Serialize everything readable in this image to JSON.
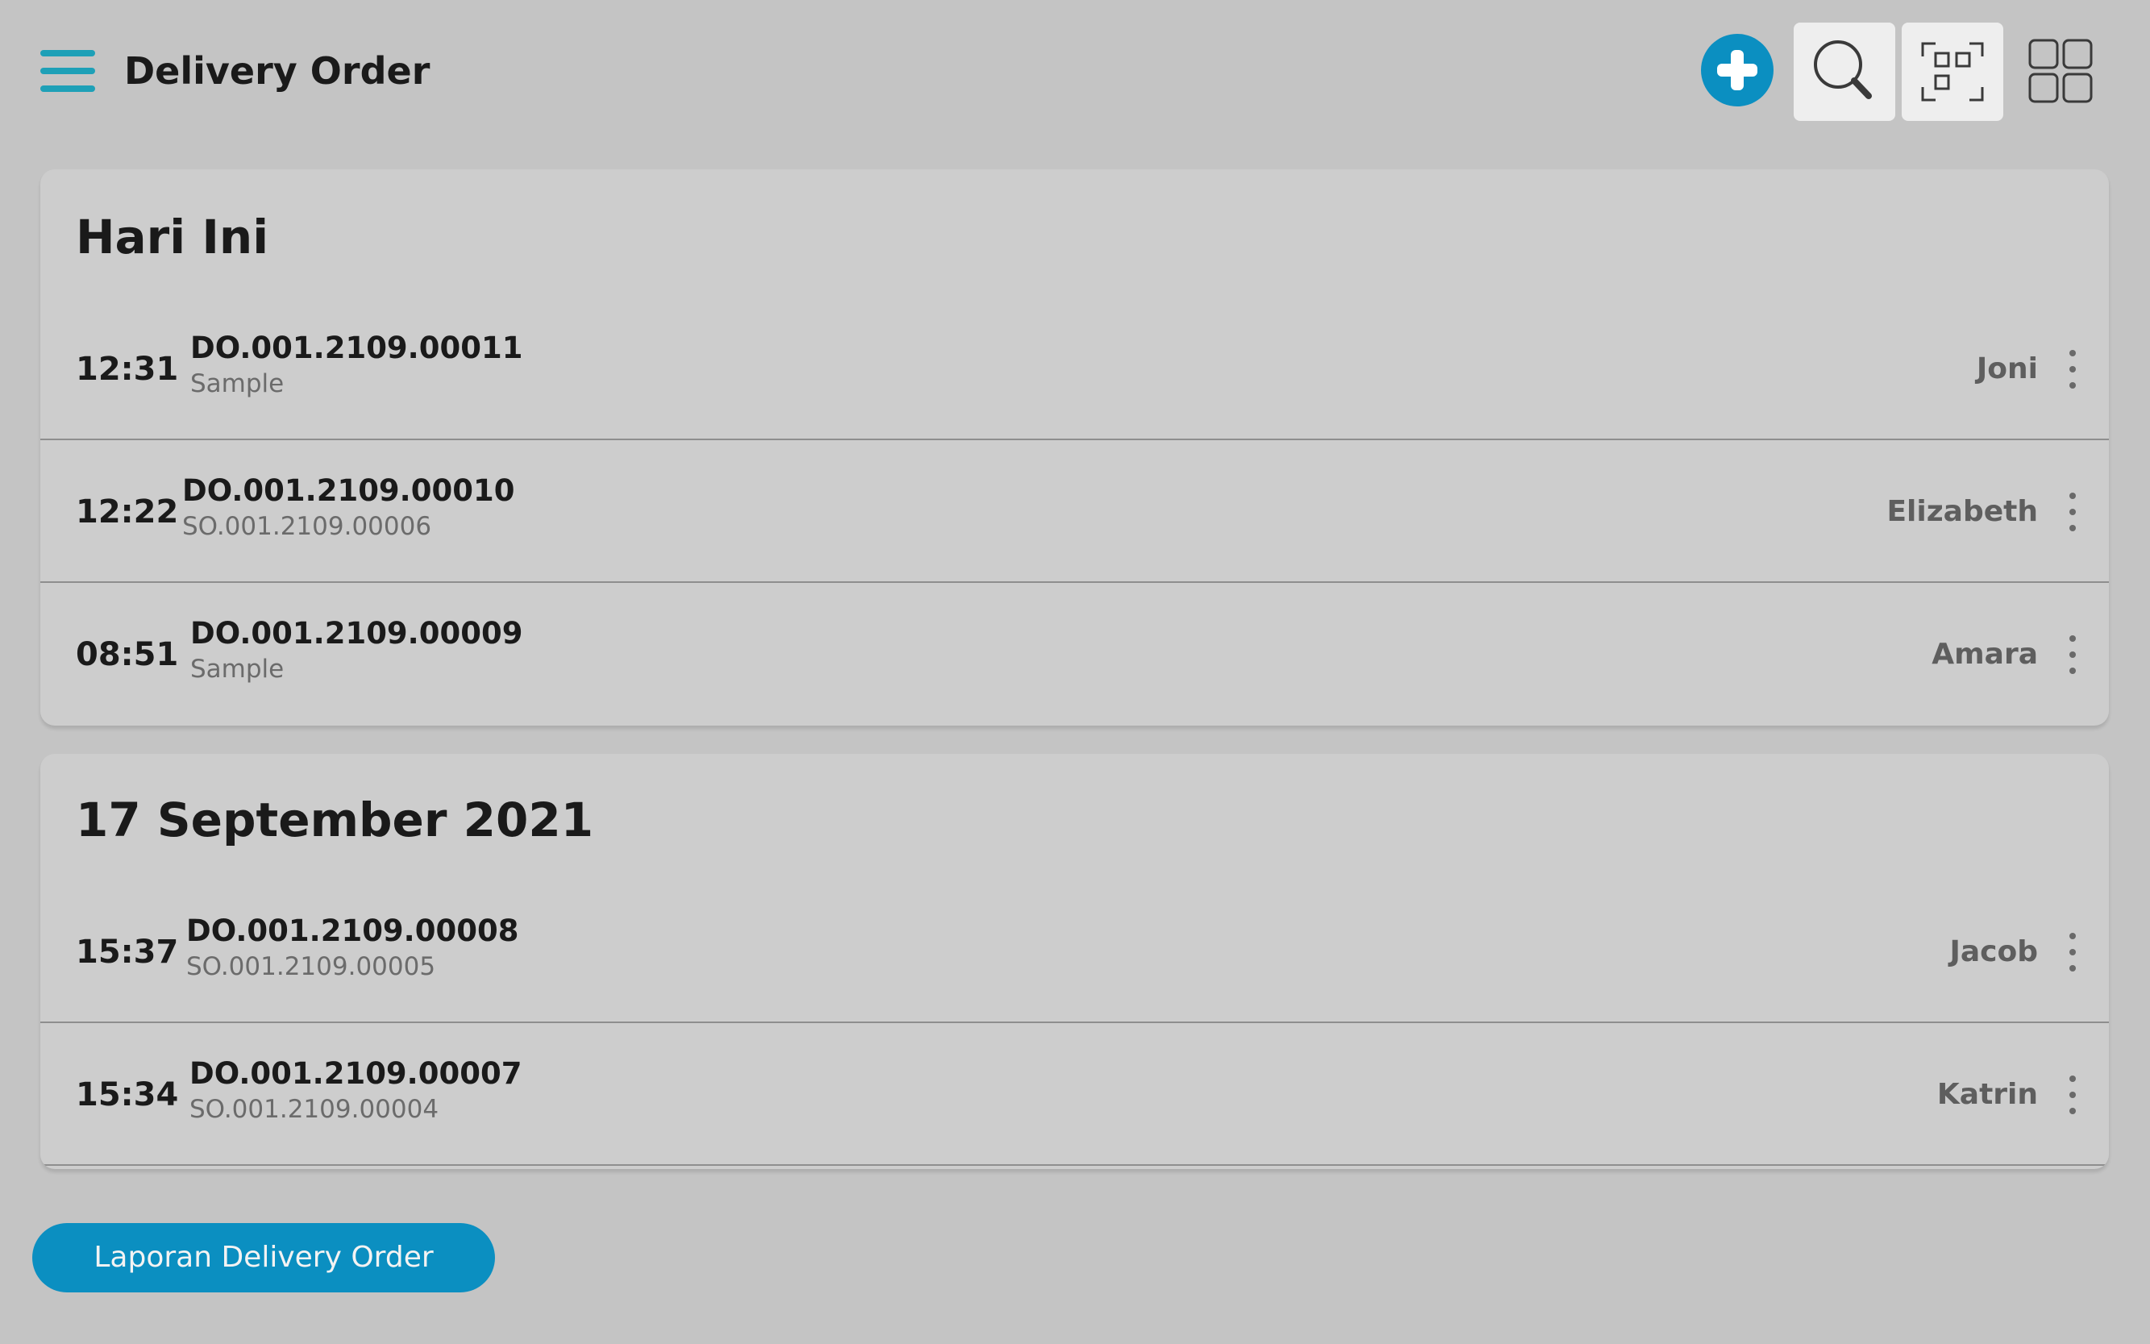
{
  "header": {
    "title": "Delivery Order"
  },
  "colors": {
    "accent": "#0b8fc1",
    "menu": "#1ea0b7",
    "background": "#c4c4c4",
    "card": "#cdcdcd"
  },
  "toolbar": {
    "icons": [
      "menu-icon",
      "add-icon",
      "search-icon",
      "qr-scan-icon",
      "grid-view-icon"
    ]
  },
  "sections": [
    {
      "title": "Hari Ini",
      "rows": [
        {
          "time": "12:31",
          "doc_no": "DO.001.2109.00011",
          "ref": "Sample",
          "person": "Joni"
        },
        {
          "time": "12:22",
          "doc_no": "DO.001.2109.00010",
          "ref": "SO.001.2109.00006",
          "person": "Elizabeth"
        },
        {
          "time": "08:51",
          "doc_no": "DO.001.2109.00009",
          "ref": "Sample",
          "person": "Amara"
        }
      ]
    },
    {
      "title": "17 September 2021",
      "rows": [
        {
          "time": "15:37",
          "doc_no": "DO.001.2109.00008",
          "ref": "SO.001.2109.00005",
          "person": "Jacob"
        },
        {
          "time": "15:34",
          "doc_no": "DO.001.2109.00007",
          "ref": "SO.001.2109.00004",
          "person": "Katrin"
        }
      ]
    }
  ],
  "footer": {
    "report_label": "Laporan Delivery Order"
  }
}
